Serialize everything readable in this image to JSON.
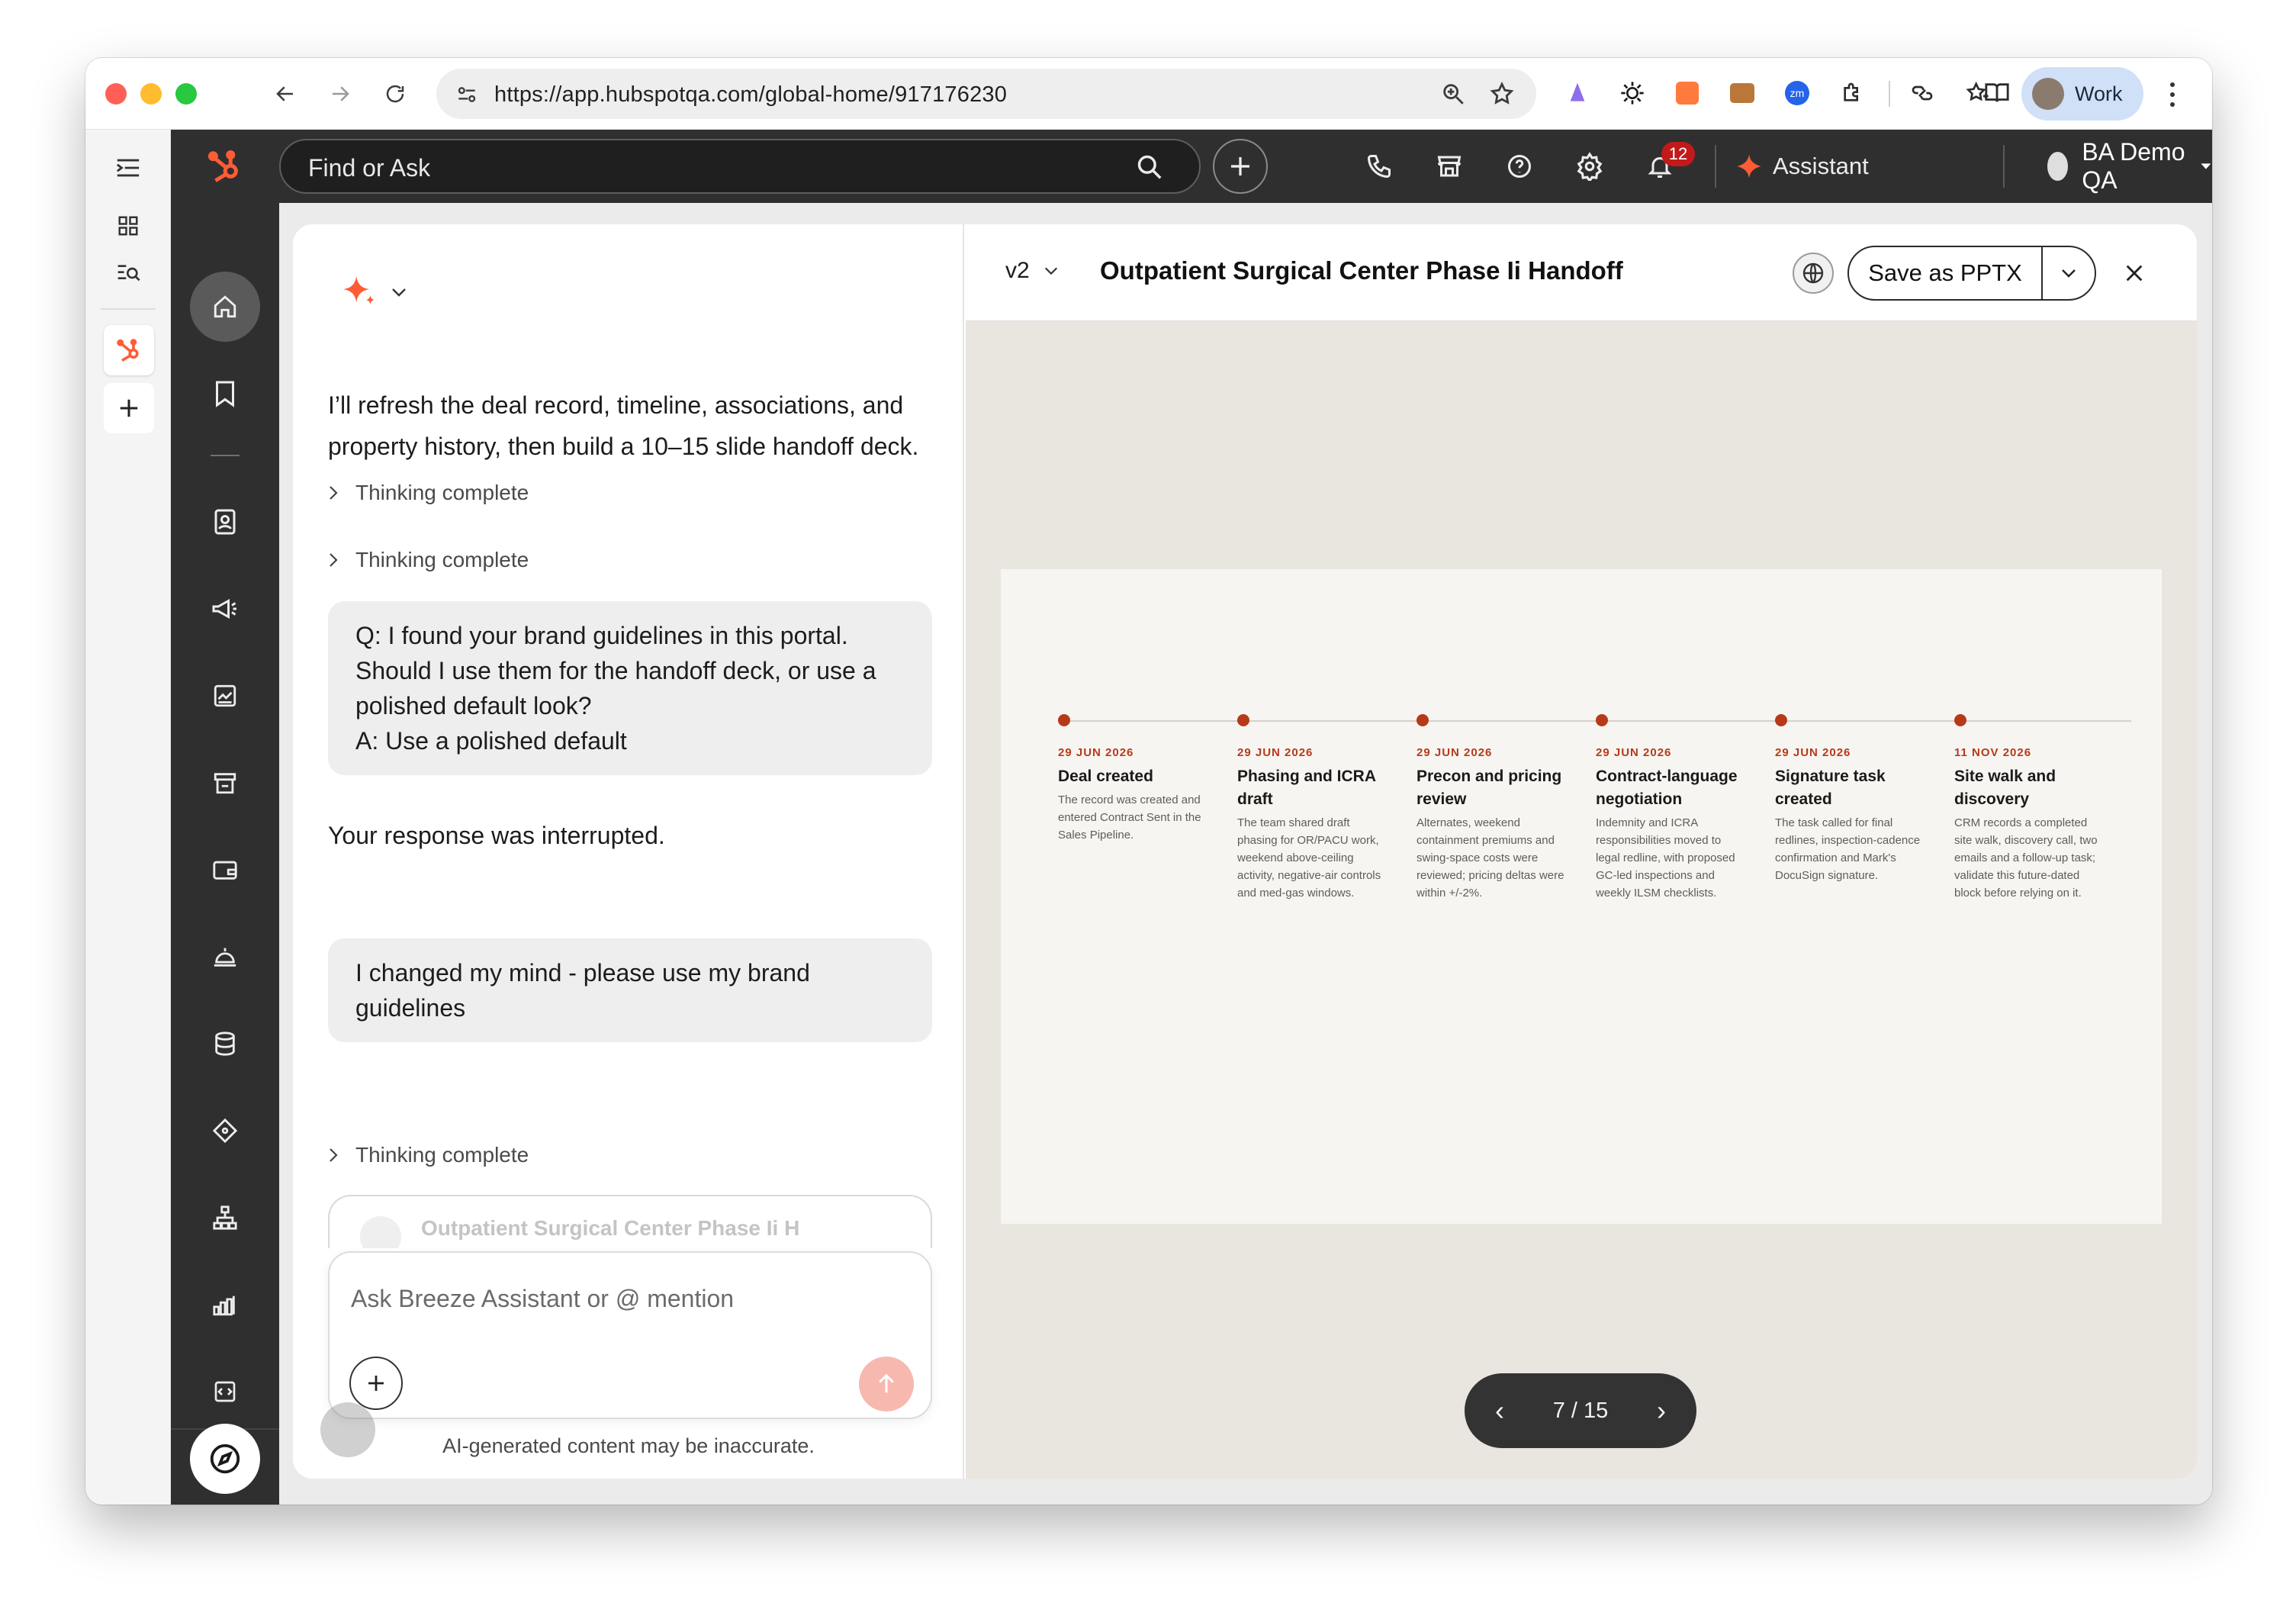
{
  "browser": {
    "url": "https://app.hubspotqa.com/global-home/917176230",
    "profile_name": "Work"
  },
  "topbar": {
    "search_placeholder": "Find or Ask",
    "notification_count": "12",
    "assistant_label": "Assistant",
    "account_name": "BA Demo QA"
  },
  "chat": {
    "intro_text": "I’ll refresh the deal record, timeline, associations, and property history, then build a 10–15 slide handoff deck.",
    "thinking_1": "Thinking complete",
    "thinking_2": "Thinking complete",
    "qa_bubble": {
      "question": "Q: I found your brand guidelines in this portal. Should I use them for the handoff deck, or use a polished default look?",
      "answer": "A: Use a polished default"
    },
    "interrupted_text": "Your response was interrupted.",
    "user_message": "I changed my mind - please use my brand guidelines",
    "thinking_3": "Thinking complete",
    "artifact_card_title": "Outpatient Surgical Center Phase Ii H",
    "composer_placeholder": "Ask Breeze Assistant or @ mention",
    "disclaimer": "AI-generated content may be inaccurate."
  },
  "preview": {
    "version": "v2",
    "title": "Outpatient Surgical Center Phase Ii Handoff",
    "save_button": "Save as PPTX",
    "pager": "7 / 15"
  },
  "timeline": [
    {
      "date": "29 JUN 2026",
      "title": "Deal created",
      "body": "The record was created and entered Contract Sent in the Sales Pipeline."
    },
    {
      "date": "29 JUN 2026",
      "title": "Phasing and ICRA draft",
      "body": "The team shared draft phasing for OR/PACU work, weekend above-ceiling activity, negative-air controls and med-gas windows."
    },
    {
      "date": "29 JUN 2026",
      "title": "Precon and pricing review",
      "body": "Alternates, weekend containment premiums and swing-space costs were reviewed; pricing deltas were within +/-2%."
    },
    {
      "date": "29 JUN 2026",
      "title": "Contract-language negotiation",
      "body": "Indemnity and ICRA responsibilities moved to legal redline, with proposed GC-led inspections and weekly ILSM checklists."
    },
    {
      "date": "29 JUN 2026",
      "title": "Signature task created",
      "body": "The task called for final redlines, inspection-cadence confirmation and Mark's DocuSign signature."
    },
    {
      "date": "11 NOV 2026",
      "title": "Site walk and discovery",
      "body": "CRM records a completed site walk, discovery call, two emails and a follow-up task; validate this future-dated block before relying on it."
    }
  ],
  "colors": {
    "accent": "#b63a1a",
    "hubspot_orange": "#ff5c35",
    "sidebar_dark": "#2f2f2f",
    "slide_bg": "#f7f5f1",
    "preview_bg": "#e9e5df"
  }
}
